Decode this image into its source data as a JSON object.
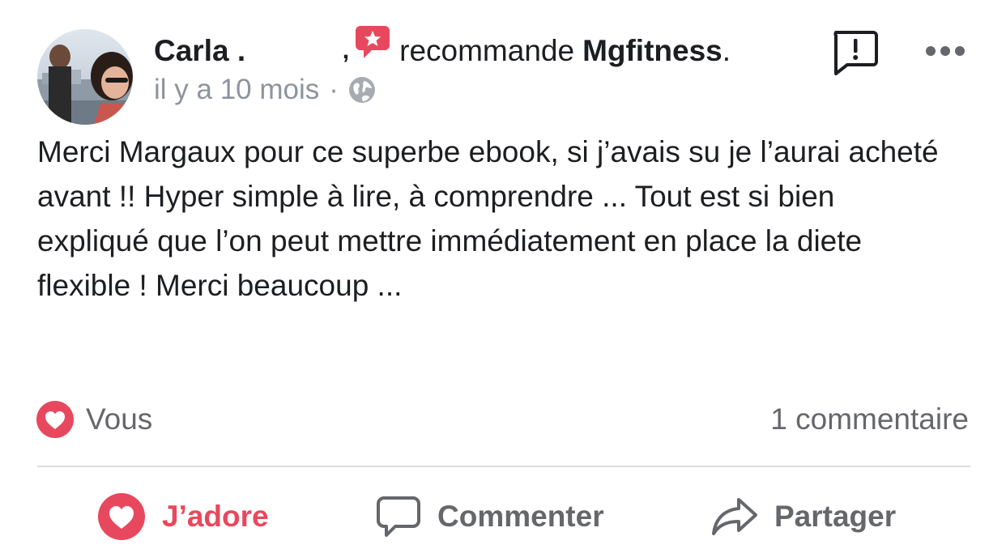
{
  "post": {
    "author": {
      "name": "Carla .",
      "name_suffix": ","
    },
    "verb": "recommande",
    "page_name": "Mgfitness",
    "period": ".",
    "timestamp": "il y a 10 mois",
    "separator": "·",
    "audience_icon": "globe-icon",
    "text": "Merci Margaux pour ce superbe ebook, si j’avais su je l’aurai acheté avant !! Hyper simple à lire, à comprendre ... Tout est si bien expliqué que l’on peut mettre immédiatement en place la diete flexible ! Merci beaucoup ..."
  },
  "reactions": {
    "label": "Vous",
    "icon": "heart-icon",
    "color": "#e8485d"
  },
  "comments": {
    "count_label": "1 commentaire"
  },
  "actions": {
    "love_label": "J’adore",
    "comment_label": "Commenter",
    "share_label": "Partager"
  },
  "icons": {
    "recommend": "recommend-star-icon",
    "report": "report-icon",
    "more": "more-dots-icon"
  },
  "colors": {
    "accent_love": "#e8485d",
    "text_secondary": "#65676b",
    "meta_gray": "#8d949e",
    "divider": "#dadde1"
  }
}
